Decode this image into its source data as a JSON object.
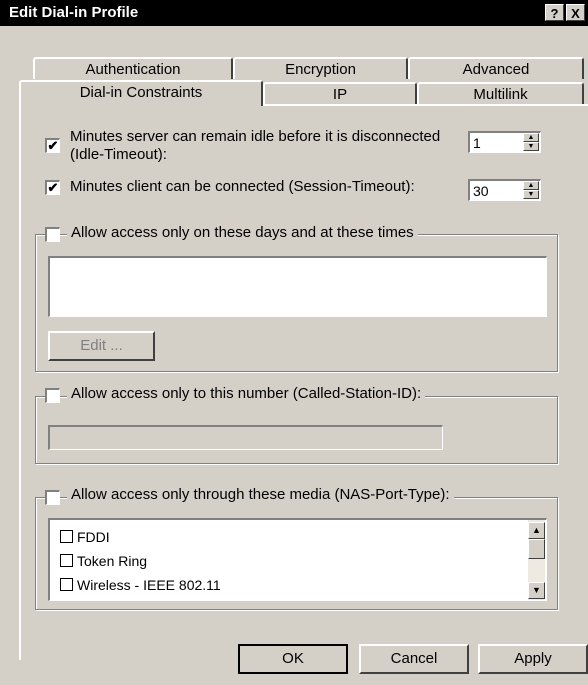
{
  "window": {
    "title": "Edit Dial-in Profile",
    "help_label": "?",
    "close_label": "X"
  },
  "tabs": {
    "row_back": [
      {
        "label": "Authentication"
      },
      {
        "label": "Encryption"
      },
      {
        "label": "Advanced"
      }
    ],
    "row_front": [
      {
        "label": "Dial-in Constraints",
        "selected": true
      },
      {
        "label": "IP"
      },
      {
        "label": "Multilink"
      }
    ]
  },
  "idle": {
    "checked": true,
    "check_mark": "✔",
    "line1": "Minutes server can remain idle before it is disconnected",
    "line2": "(Idle-Timeout):",
    "value": "1"
  },
  "session": {
    "checked": true,
    "check_mark": "✔",
    "label": "Minutes client can be connected (Session-Timeout):",
    "value": "30"
  },
  "days": {
    "checked": false,
    "label": "Allow access only on these days and at these times",
    "edit_label": "Edit ..."
  },
  "number": {
    "checked": false,
    "label": "Allow access only to this number (Called-Station-ID):",
    "value": ""
  },
  "media": {
    "checked": false,
    "label": "Allow access only through these media (NAS-Port-Type):",
    "items": [
      {
        "label": "FDDI",
        "checked": false
      },
      {
        "label": "Token Ring",
        "checked": false
      },
      {
        "label": "Wireless - IEEE 802.11",
        "checked": false
      }
    ]
  },
  "buttons": {
    "ok": "OK",
    "cancel": "Cancel",
    "apply": "Apply"
  },
  "icons": {
    "up": "▲",
    "down": "▼"
  }
}
